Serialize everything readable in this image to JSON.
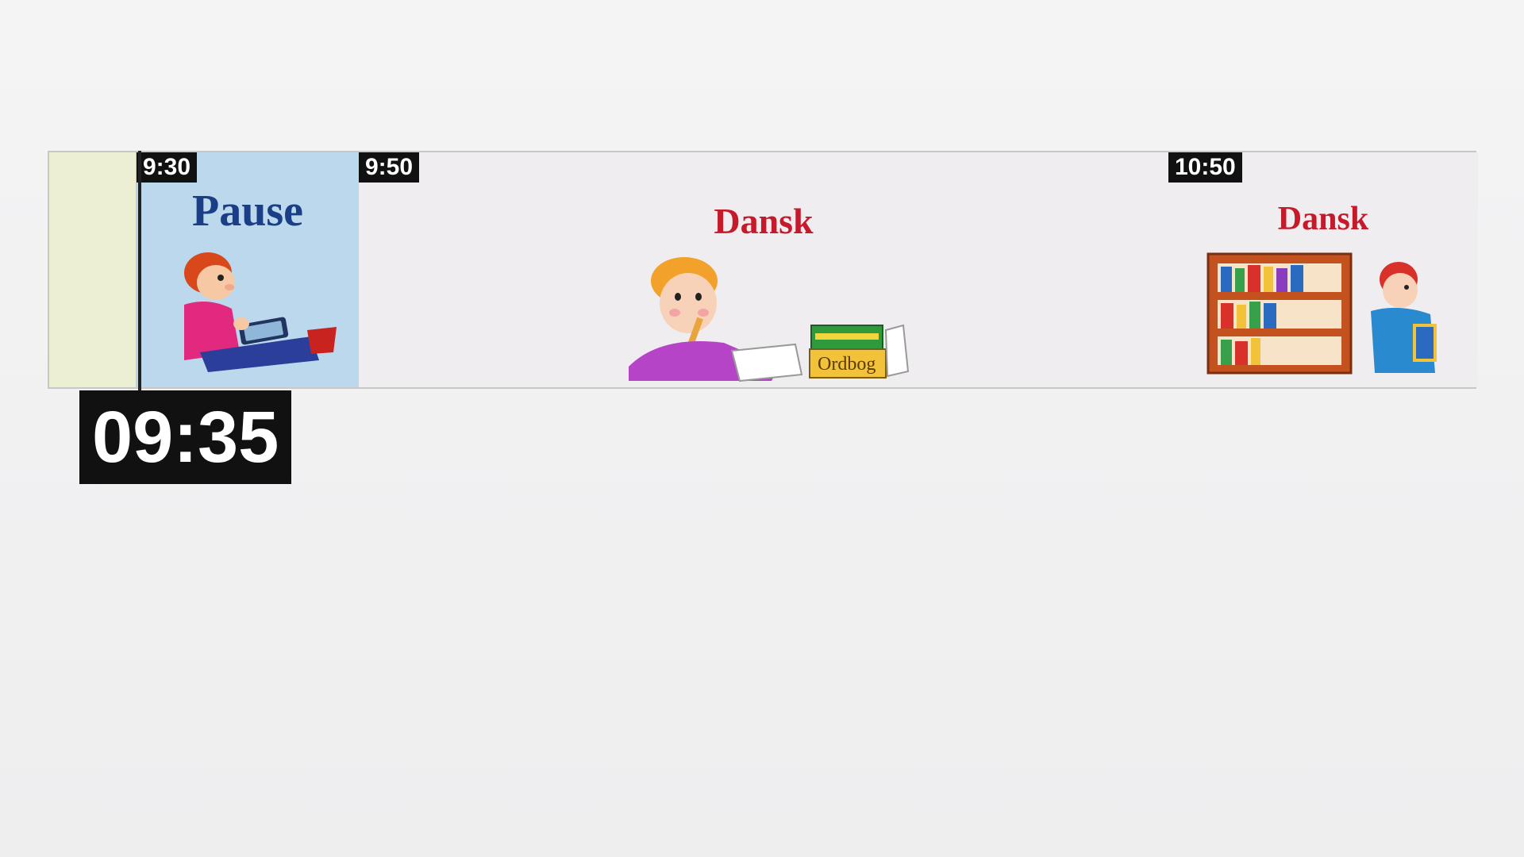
{
  "schedule": {
    "blocks": [
      {
        "time": "9:30",
        "title": "Pause"
      },
      {
        "time": "9:50",
        "title": "Dansk",
        "book_label": "Ordbog"
      },
      {
        "time": "10:50",
        "title": "Dansk"
      }
    ]
  },
  "clock": {
    "current_time": "09:35"
  },
  "colors": {
    "pause_bg": "#bcd8ec",
    "pause_title": "#1b3f86",
    "dansk_title": "#c61a2a",
    "past_bg": "#ecefd1",
    "tag_bg": "#111111"
  }
}
